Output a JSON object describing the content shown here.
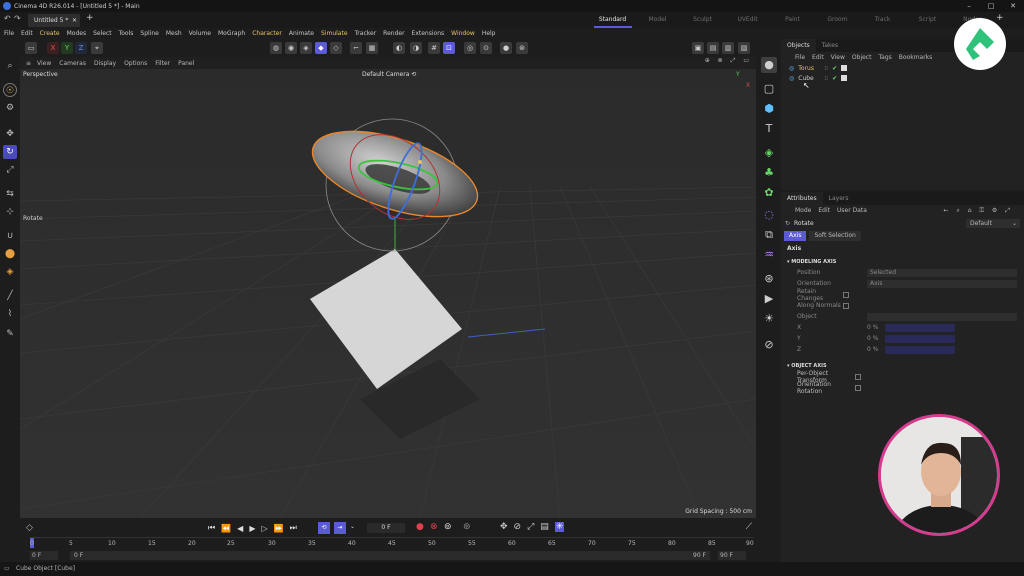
{
  "window": {
    "title": "Cinema 4D R26.014 - [Untitled 5 *] - Main",
    "doc_tab": "Untitled 5 *",
    "new_tab": "+",
    "controls": [
      "–",
      "□",
      "✕"
    ]
  },
  "layouts": {
    "items": [
      "Standard",
      "Model",
      "Sculpt",
      "UVEdit",
      "Paint",
      "Groom",
      "Track",
      "Script",
      "Nodes"
    ],
    "active": "Standard",
    "add": "+"
  },
  "menu": {
    "items": [
      "File",
      "Edit",
      "Create",
      "Modes",
      "Select",
      "Tools",
      "Spline",
      "Mesh",
      "Volume",
      "MoGraph",
      "Character",
      "Animate",
      "Simulate",
      "Tracker",
      "Render",
      "Extensions",
      "Window",
      "Help"
    ],
    "highlight": [
      "Create",
      "Character",
      "Simulate",
      "Window"
    ]
  },
  "toolbar": {
    "axis": [
      "X",
      "Y",
      "Z"
    ]
  },
  "viewport": {
    "menu": [
      "View",
      "Cameras",
      "Display",
      "Options",
      "Filter",
      "Panel"
    ],
    "label": "Perspective",
    "camera": "Default Camera ⟲",
    "tool_label": "Rotate",
    "grid_spacing": "Grid Spacing : 500 cm",
    "axis_y": "Y",
    "axis_x": "X"
  },
  "objects": {
    "tabs": [
      "Objects",
      "Takes"
    ],
    "menu": [
      "File",
      "Edit",
      "View",
      "Object",
      "Tags",
      "Bookmarks"
    ],
    "items": [
      {
        "name": "Torus",
        "selected": true
      },
      {
        "name": "Cube",
        "selected": false
      }
    ]
  },
  "attributes": {
    "tabs": [
      "Attributes",
      "Layers"
    ],
    "menu": [
      "Mode",
      "Edit",
      "User Data"
    ],
    "tool_name": "Rotate",
    "preset": "Default",
    "subtabs": [
      "Axis",
      "Soft Selection"
    ],
    "section": "Axis",
    "modeling_axis": {
      "title": "MODELING AXIS",
      "props": [
        {
          "label": "Position",
          "value": "Selected"
        },
        {
          "label": "Orientation",
          "value": "Axis"
        },
        {
          "label": "Retain Changes",
          "value": ""
        },
        {
          "label": "Along Normals",
          "value": ""
        },
        {
          "label": "Object",
          "value": ""
        }
      ],
      "xyz": [
        {
          "label": "X",
          "value": "0 %"
        },
        {
          "label": "Y",
          "value": "0 %"
        },
        {
          "label": "Z",
          "value": "0 %"
        }
      ]
    },
    "object_axis": {
      "title": "OBJECT AXIS",
      "props": [
        {
          "label": "Per-Object Transform"
        },
        {
          "label": "Orientation Rotation"
        }
      ]
    }
  },
  "timeline": {
    "current_frame": "0 F",
    "ticks": [
      "0",
      "5",
      "10",
      "15",
      "20",
      "25",
      "30",
      "35",
      "40",
      "45",
      "50",
      "55",
      "60",
      "65",
      "70",
      "75",
      "80",
      "85",
      "90"
    ],
    "start": "0 F",
    "start2": "0 F",
    "end": "90 F",
    "end2": "90 F"
  },
  "status": {
    "text": "Cube Object [Cube]"
  },
  "colors": {
    "accent": "#5b5bd6",
    "highlight": "#e6c36a",
    "torus_outline": "#e8872a"
  }
}
